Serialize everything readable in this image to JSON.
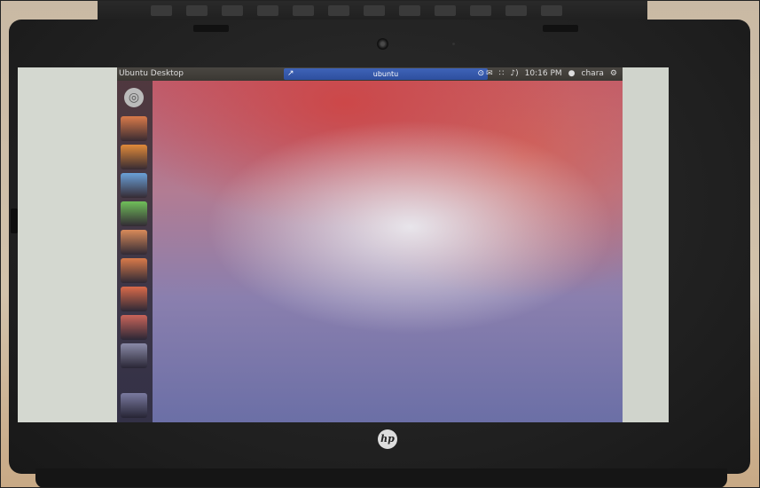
{
  "top_panel": {
    "title": "Ubuntu Desktop",
    "search_text": "ubuntu",
    "clock": "10:16 PM",
    "user": "chara"
  },
  "hp_logo": "hp",
  "launcher": {
    "items": [
      {
        "icon": "files-icon",
        "color": "#d97a4a"
      },
      {
        "icon": "browser-icon",
        "color": "#e08a3a"
      },
      {
        "icon": "writer-icon",
        "color": "#6aa0d8"
      },
      {
        "icon": "calc-icon",
        "color": "#6fbf5a"
      },
      {
        "icon": "impress-icon",
        "color": "#d98a5a"
      },
      {
        "icon": "software-center-icon",
        "color": "#d97a4a"
      },
      {
        "icon": "ubuntu-one-icon",
        "color": "#d96a4a"
      },
      {
        "icon": "settings-icon",
        "color": "#c9645a"
      },
      {
        "icon": "workspace-icon",
        "color": "#8a8aa8"
      },
      {
        "icon": "trash-icon",
        "color": "#7a7aa0"
      }
    ]
  }
}
